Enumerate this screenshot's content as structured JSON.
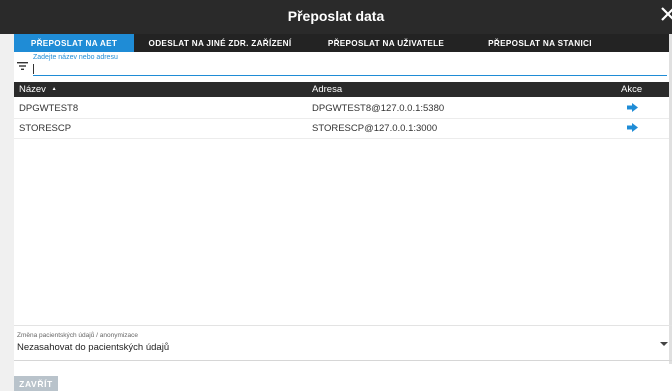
{
  "window": {
    "title": "Přeposlat data"
  },
  "tabs": [
    {
      "label": "PŘEPOSLAT NA AET",
      "active": true
    },
    {
      "label": "ODESLAT NA JINÉ ZDR. ZAŘÍZENÍ",
      "active": false
    },
    {
      "label": "PŘEPOSLAT NA UŽIVATELE",
      "active": false
    },
    {
      "label": "PŘEPOSLAT NA STANICI",
      "active": false
    }
  ],
  "filter": {
    "label": "Zadejte název nebo adresu",
    "value": ""
  },
  "table": {
    "columns": {
      "name": "Název",
      "address": "Adresa",
      "action": "Akce"
    },
    "sort_indicator": "▲",
    "rows": [
      {
        "name": "DPGWTEST8",
        "address": "DPGWTEST8@127.0.0.1:5380"
      },
      {
        "name": "STORESCP",
        "address": "STORESCP@127.0.0.1:3000"
      }
    ]
  },
  "anonymization": {
    "label": "Změna pacientských údajů / anonymizace",
    "value": "Nezasahovat do pacientských údajů"
  },
  "footer": {
    "close_label": "ZAVŘÍT"
  },
  "colors": {
    "accent": "#1f8cd6",
    "header_bg": "#2a2a2a",
    "disabled_button": "#b9c3cb"
  }
}
